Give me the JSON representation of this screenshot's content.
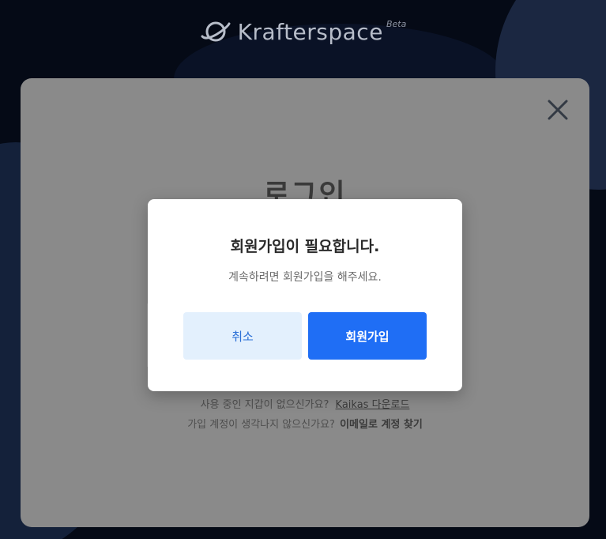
{
  "header": {
    "brand": "Krafterspace",
    "badge": "Beta",
    "logo_icon": "planet-logo-icon"
  },
  "login_panel": {
    "title": "로그인",
    "close_icon": "close-icon",
    "wallet_question": "사용 중인 지갑이 없으신가요?",
    "wallet_link": "Kaikas 다운로드",
    "account_question": "가입 계정이 생각나지 않으신가요?",
    "account_link": "이메일로 계정 찾기"
  },
  "modal": {
    "title": "회원가입이 필요합니다.",
    "description": "계속하려면 회원가입을 해주세요.",
    "cancel_label": "취소",
    "signup_label": "회원가입"
  },
  "colors": {
    "primary": "#1f6ef5",
    "cancel_bg": "#e3f0fd",
    "cancel_text": "#2a6fd6",
    "background": "#050a16",
    "overlay_panel": "#8a8a8a"
  }
}
